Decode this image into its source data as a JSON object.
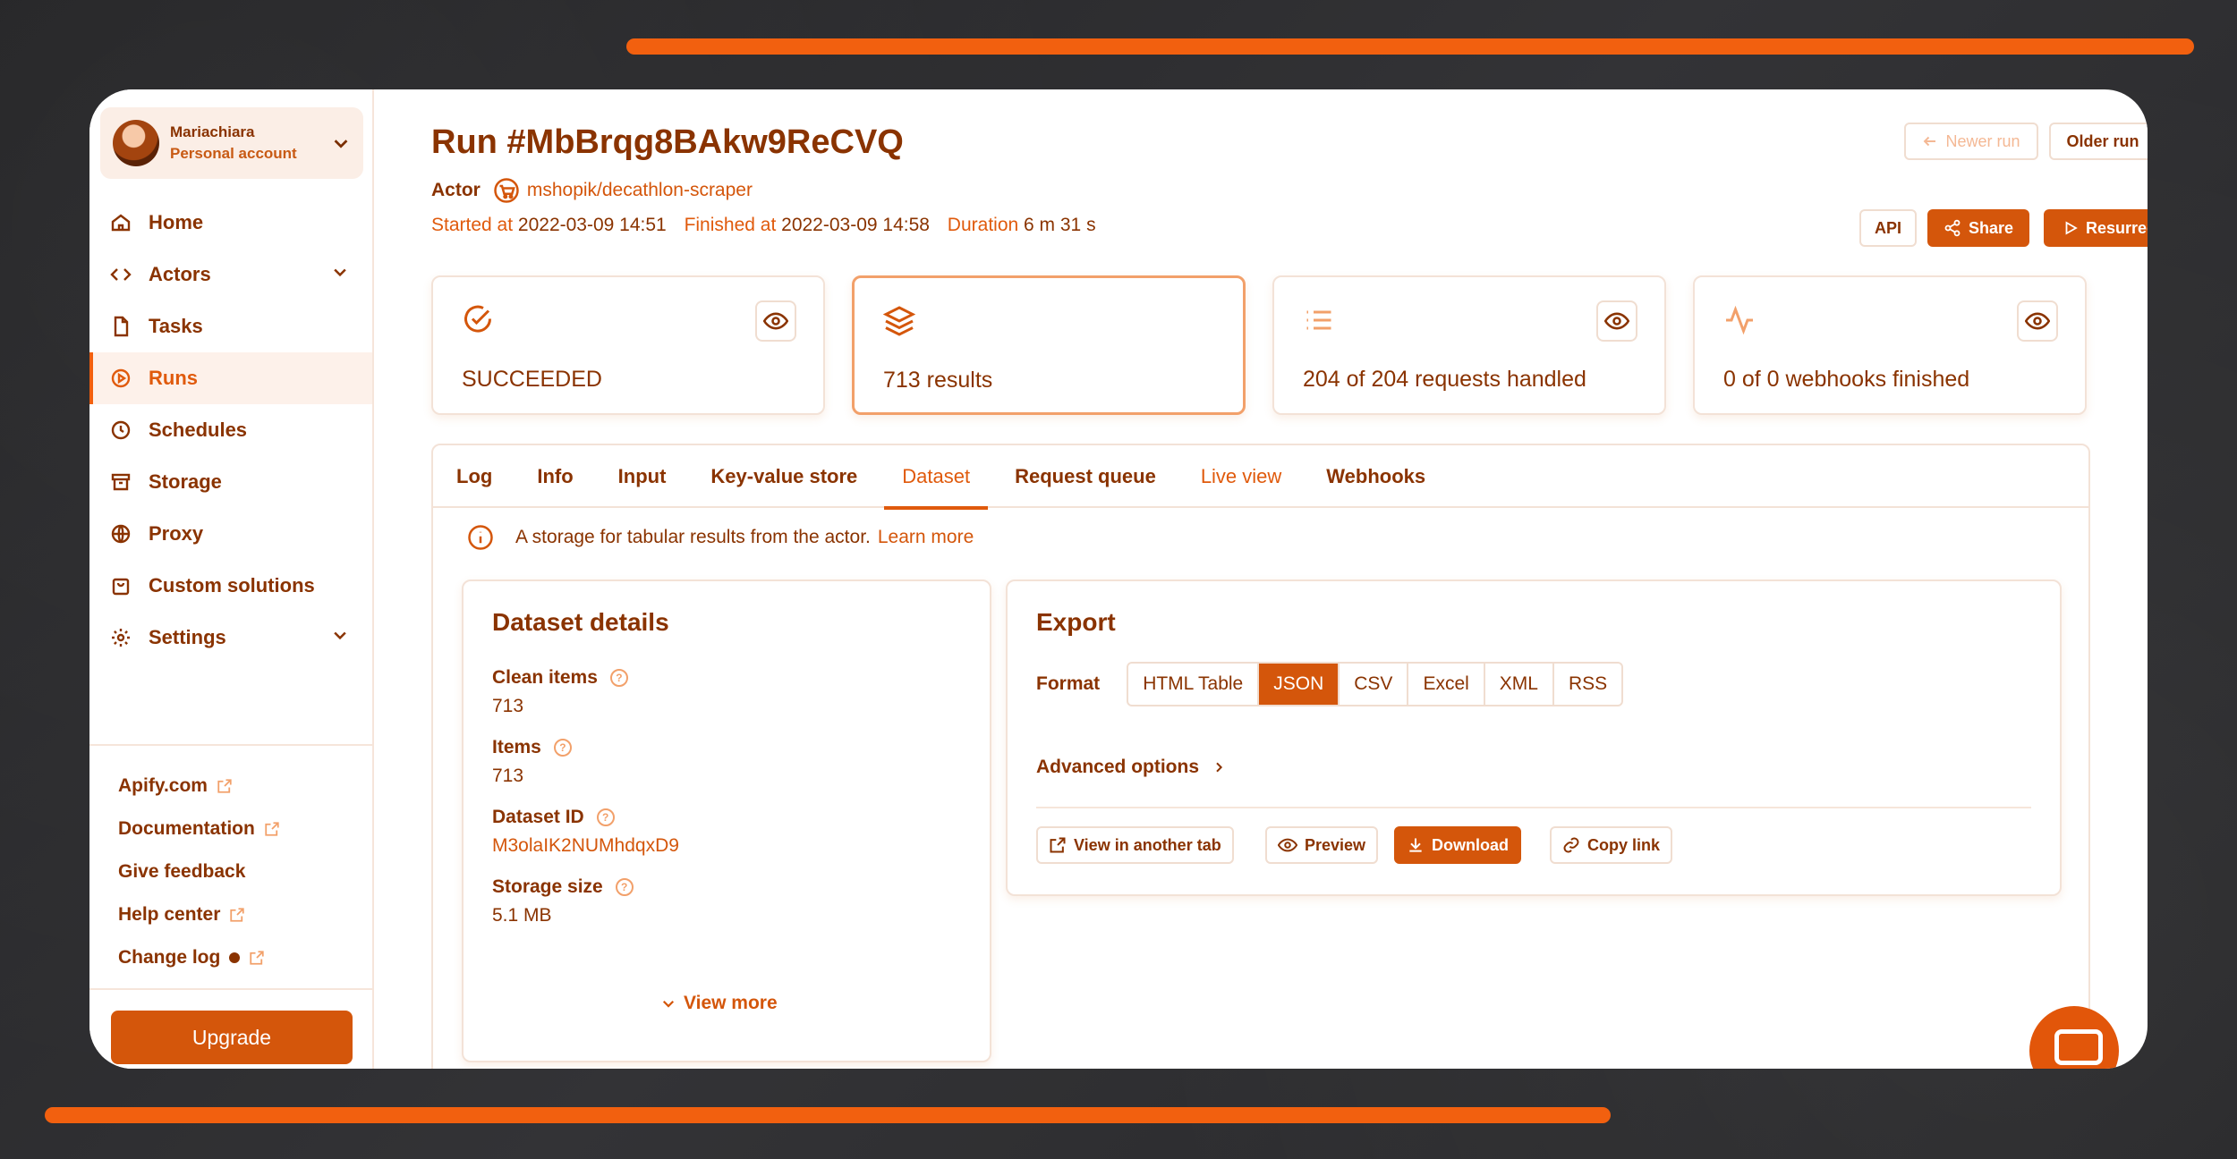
{
  "account": {
    "name": "Mariachiara",
    "type": "Personal account"
  },
  "nav": [
    {
      "label": "Home",
      "icon": "home-icon"
    },
    {
      "label": "Actors",
      "icon": "code-icon",
      "caret": true
    },
    {
      "label": "Tasks",
      "icon": "file-icon"
    },
    {
      "label": "Runs",
      "icon": "play-circle-icon",
      "active": true
    },
    {
      "label": "Schedules",
      "icon": "clock-icon"
    },
    {
      "label": "Storage",
      "icon": "archive-icon"
    },
    {
      "label": "Proxy",
      "icon": "globe-icon"
    },
    {
      "label": "Custom solutions",
      "icon": "bag-icon"
    },
    {
      "label": "Settings",
      "icon": "gear-icon",
      "caret": true
    }
  ],
  "links": [
    {
      "label": "Apify.com",
      "external": true
    },
    {
      "label": "Documentation",
      "external": true
    },
    {
      "label": "Give feedback",
      "external": false
    },
    {
      "label": "Help center",
      "external": true
    },
    {
      "label": "Change log",
      "external": true,
      "dot": true
    }
  ],
  "upgrade_label": "Upgrade",
  "run": {
    "title": "Run #MbBrqg8BAkw9ReCVQ",
    "actor_label": "Actor",
    "actor_name": "mshopik/decathlon-scraper",
    "started_label": "Started at",
    "started": "2022-03-09 14:51",
    "finished_label": "Finished at",
    "finished": "2022-03-09 14:58",
    "duration_label": "Duration",
    "duration": "6 m 31 s"
  },
  "toolbar": {
    "newer": "Newer run",
    "older": "Older run",
    "api": "API",
    "share": "Share",
    "resurrect": "Resurrect"
  },
  "stats": [
    {
      "text": "SUCCEEDED",
      "icon": "check-circle-icon",
      "eye": true
    },
    {
      "text": "713 results",
      "icon": "layers-icon",
      "eye": false,
      "selected": true
    },
    {
      "text": "204 of 204 requests handled",
      "icon": "list-icon",
      "eye": true
    },
    {
      "text": "0 of 0 webhooks finished",
      "icon": "activity-icon",
      "eye": true
    }
  ],
  "tabs": [
    "Log",
    "Info",
    "Input",
    "Key-value store",
    "Dataset",
    "Request queue",
    "Live view",
    "Webhooks"
  ],
  "active_tab": "Dataset",
  "info": {
    "text": "A storage for tabular results from the actor.",
    "link": "Learn more"
  },
  "dataset": {
    "title": "Dataset details",
    "clean_items_label": "Clean items",
    "clean_items": "713",
    "items_label": "Items",
    "items": "713",
    "id_label": "Dataset ID",
    "id": "M3olaIK2NUMhdqxD9",
    "size_label": "Storage size",
    "size": "5.1 MB",
    "view_more": "View more"
  },
  "export": {
    "title": "Export",
    "format_label": "Format",
    "formats": [
      "HTML Table",
      "JSON",
      "CSV",
      "Excel",
      "XML",
      "RSS"
    ],
    "selected_format": "JSON",
    "advanced": "Advanced options",
    "view_tab": "View in another tab",
    "preview": "Preview",
    "download": "Download",
    "copy_link": "Copy link"
  },
  "colors": {
    "accent": "#d4560b",
    "stripe": "#f2600f",
    "text": "#8a3300"
  }
}
